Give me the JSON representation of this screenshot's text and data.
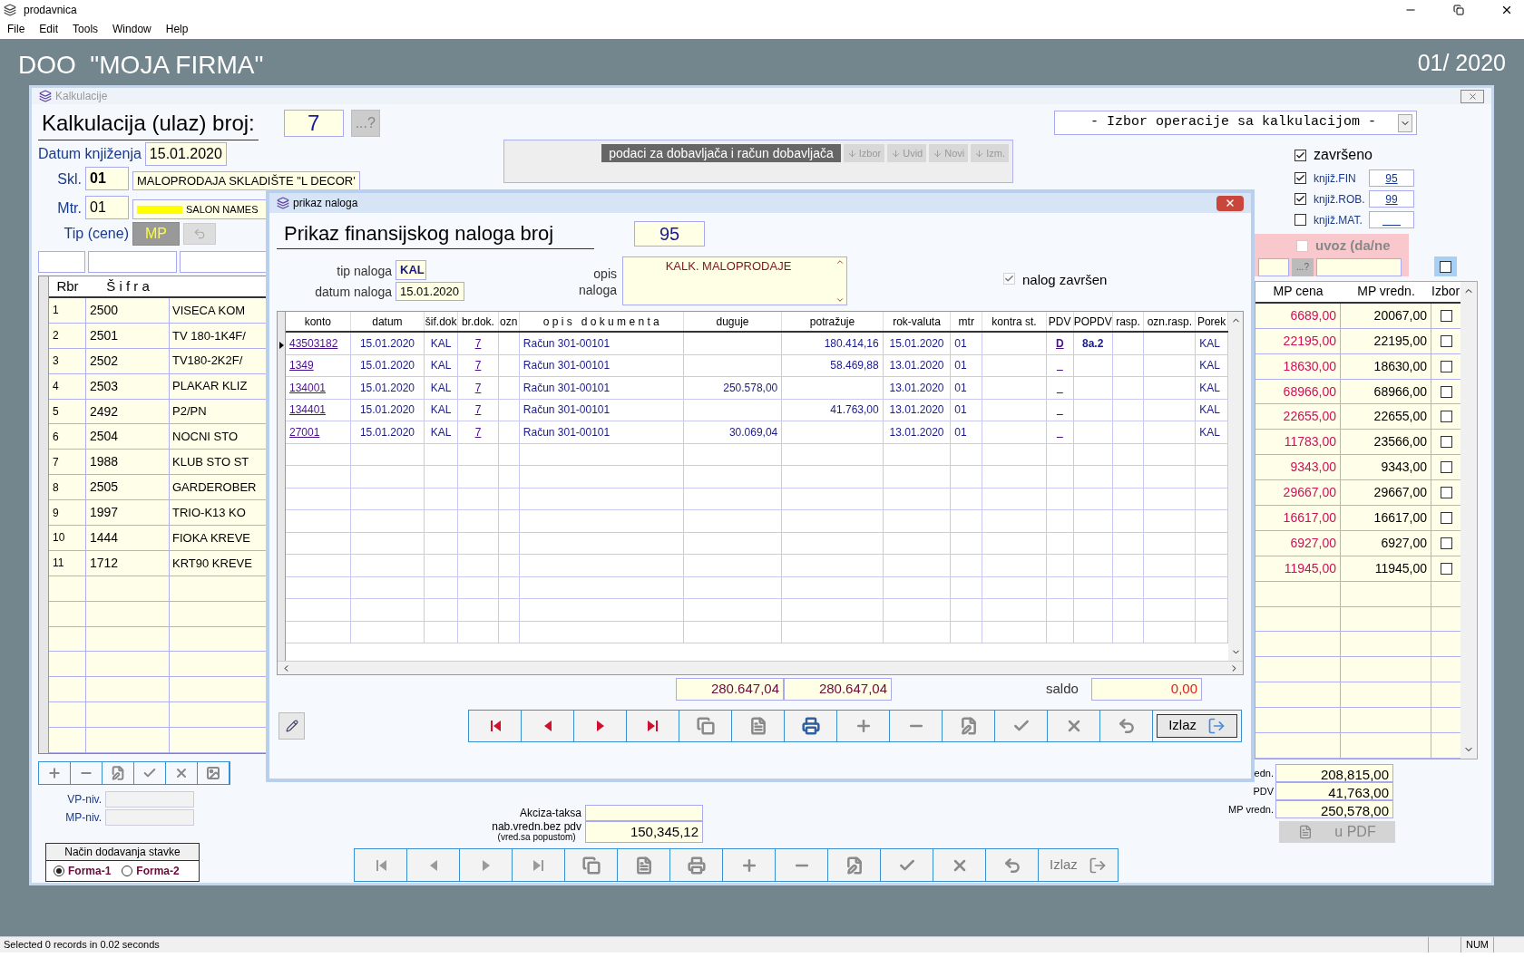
{
  "app": {
    "title": "prodavnica",
    "menu": [
      "File",
      "Edit",
      "Tools",
      "Window",
      "Help"
    ]
  },
  "company": "DOO  \"MOJA FIRMA\"",
  "period": "01/ 2020",
  "kalk": {
    "title": "Kalkulacije",
    "heading": "Kalkulacija (ulaz) broj:",
    "number": "7",
    "lookup": "...?",
    "datum_label": "Datum knjiženja",
    "datum": "15.01.2020",
    "skl_label": "Skl.",
    "skl": "01",
    "skl_name": "MALOPRODAJA SKLADIŠTE \"L DECOR'",
    "mtr_label": "Mtr.",
    "mtr": "01",
    "mtr_name": "SALON NAMES",
    "tip_label": "Tip (cene)",
    "tip": "MP",
    "supplier_panel": {
      "title": "podaci za dobavljača i račun dobavljača",
      "buttons": [
        "Izbor",
        "Uvid",
        "Novi",
        "Izm."
      ]
    },
    "operation": "- Izbor operacije sa kalkulacijom -",
    "zavrseno": {
      "label": "završeno",
      "checked": true
    },
    "knjizenja": [
      {
        "label": "knjiž.FIN",
        "checked": true,
        "value": "95"
      },
      {
        "label": "knjiž.ROB.",
        "checked": true,
        "value": "99"
      },
      {
        "label": "knjiž.MAT.",
        "checked": false
      }
    ],
    "uvoz": {
      "label": "uvoz (da/ne",
      "checked": false,
      "lookup": "...?"
    },
    "izbor_all": {
      "checked": false
    },
    "columns": {
      "rbr": "Rbr",
      "sifra": "Š i f r a",
      "mp_cena": "MP cena",
      "mp_vredn": "MP vredn.",
      "izbor": "Izbor"
    },
    "rows": [
      {
        "rbr": "1",
        "sifra": "2500",
        "naziv": "VISECA KOM",
        "mp_cena": "6689,00",
        "mp_vredn": "20067,00",
        "izbor": false
      },
      {
        "rbr": "2",
        "sifra": "2501",
        "naziv": "TV 180-1K4F/",
        "mp_cena": "22195,00",
        "mp_vredn": "22195,00",
        "izbor": false
      },
      {
        "rbr": "3",
        "sifra": "2502",
        "naziv": "TV180-2K2F/",
        "mp_cena": "18630,00",
        "mp_vredn": "18630,00",
        "izbor": false
      },
      {
        "rbr": "4",
        "sifra": "2503",
        "naziv": "PLAKAR KLIZ",
        "mp_cena": "68966,00",
        "mp_vredn": "68966,00",
        "izbor": false
      },
      {
        "rbr": "5",
        "sifra": "2492",
        "naziv": "P2/PN",
        "mp_cena": "22655,00",
        "mp_vredn": "22655,00",
        "izbor": false
      },
      {
        "rbr": "6",
        "sifra": "2504",
        "naziv": "NOCNI STO",
        "mp_cena": "11783,00",
        "mp_vredn": "23566,00",
        "izbor": false
      },
      {
        "rbr": "7",
        "sifra": "1988",
        "naziv": "KLUB STO ST",
        "mp_cena": "9343,00",
        "mp_vredn": "9343,00",
        "izbor": false
      },
      {
        "rbr": "8",
        "sifra": "2505",
        "naziv": "GARDEROBER",
        "mp_cena": "29667,00",
        "mp_vredn": "29667,00",
        "izbor": false
      },
      {
        "rbr": "9",
        "sifra": "1997",
        "naziv": "TRIO-K13 KO",
        "mp_cena": "16617,00",
        "mp_vredn": "16617,00",
        "izbor": false
      },
      {
        "rbr": "10",
        "sifra": "1444",
        "naziv": "FIOKA KREVE",
        "mp_cena": "6927,00",
        "mp_vredn": "6927,00",
        "izbor": false
      },
      {
        "rbr": "11",
        "sifra": "1712",
        "naziv": "KRT90 KREVE",
        "mp_cena": "11945,00",
        "mp_vredn": "11945,00",
        "izbor": false
      }
    ],
    "totals": [
      {
        "label": "edn.",
        "value": "208,815,00"
      },
      {
        "label": "PDV",
        "value": "41,763,00"
      },
      {
        "label": "MP vredn.",
        "value": "250,578,00"
      }
    ],
    "pdf_button": "u PDF",
    "niv": [
      "VP-niv.",
      "MP-niv."
    ],
    "mode": {
      "title": "Način dodavanja stavke",
      "options": [
        {
          "label": "Forma-1",
          "selected": true
        },
        {
          "label": "Forma-2",
          "selected": false
        }
      ]
    },
    "akciza_label": "Akciza-taksa",
    "nab_label": "nab.vredn.bez pdv",
    "nab_sub": "(vred.sa popustom)",
    "nab_value": "150,345,12",
    "exit": "Izlaz"
  },
  "dialog": {
    "title": "prikaz naloga",
    "heading": "Prikaz finansijskog naloga broj",
    "number": "95",
    "tip_label": "tip naloga",
    "tip": "KAL",
    "datum_label": "datum naloga",
    "datum": "15.01.2020",
    "opis_label": "opis\nnaloga",
    "opis": "KALK. MALOPRODAJE",
    "zavrsen": {
      "label": "nalog završen",
      "checked": true
    },
    "columns": [
      "konto",
      "datum",
      "šif.dok",
      "br.dok.",
      "ozn",
      "o p i s   d o k u m e n t a",
      "duguje",
      "potražuje",
      "rok-valuta",
      "mtr",
      "kontra st.",
      "PDV",
      "POPDV",
      "rasp.",
      "ozn.rasp.",
      "Porek"
    ],
    "rows": [
      {
        "selected": true,
        "cells": [
          "43503182",
          "15.01.2020",
          "KAL",
          "7",
          null,
          "Račun 301-00101",
          null,
          "180.414,16",
          "15.01.2020",
          "01",
          null,
          "D",
          "8a.2",
          null,
          null,
          "KAL"
        ]
      },
      {
        "selected": false,
        "cells": [
          "1349",
          "15.01.2020",
          "KAL",
          "7",
          null,
          "Račun 301-00101",
          null,
          "58.469,88",
          "13.01.2020",
          "01",
          null,
          "_",
          null,
          null,
          null,
          "KAL"
        ]
      },
      {
        "selected": false,
        "cells": [
          "134001",
          "15.01.2020",
          "KAL",
          "7",
          null,
          "Račun 301-00101",
          "250.578,00",
          null,
          "13.01.2020",
          "01",
          null,
          "_",
          null,
          null,
          null,
          "KAL"
        ]
      },
      {
        "selected": false,
        "cells": [
          "134401",
          "15.01.2020",
          "KAL",
          "7",
          null,
          "Račun 301-00101",
          null,
          "41.763,00",
          "13.01.2020",
          "01",
          null,
          "_",
          null,
          null,
          null,
          "KAL"
        ]
      },
      {
        "selected": false,
        "cells": [
          "27001",
          "15.01.2020",
          "KAL",
          "7",
          null,
          "Račun 301-00101",
          "30.069,04",
          null,
          "13.01.2020",
          "01",
          null,
          "_",
          null,
          null,
          null,
          "KAL"
        ]
      }
    ],
    "sum_duguje": "280.647,04",
    "sum_potrazuje": "280.647,04",
    "saldo_label": "saldo",
    "saldo": "0,00",
    "exit": "Izlaz"
  },
  "status": {
    "text": "Selected 0 records in 0.02 seconds",
    "num": "NUM"
  }
}
